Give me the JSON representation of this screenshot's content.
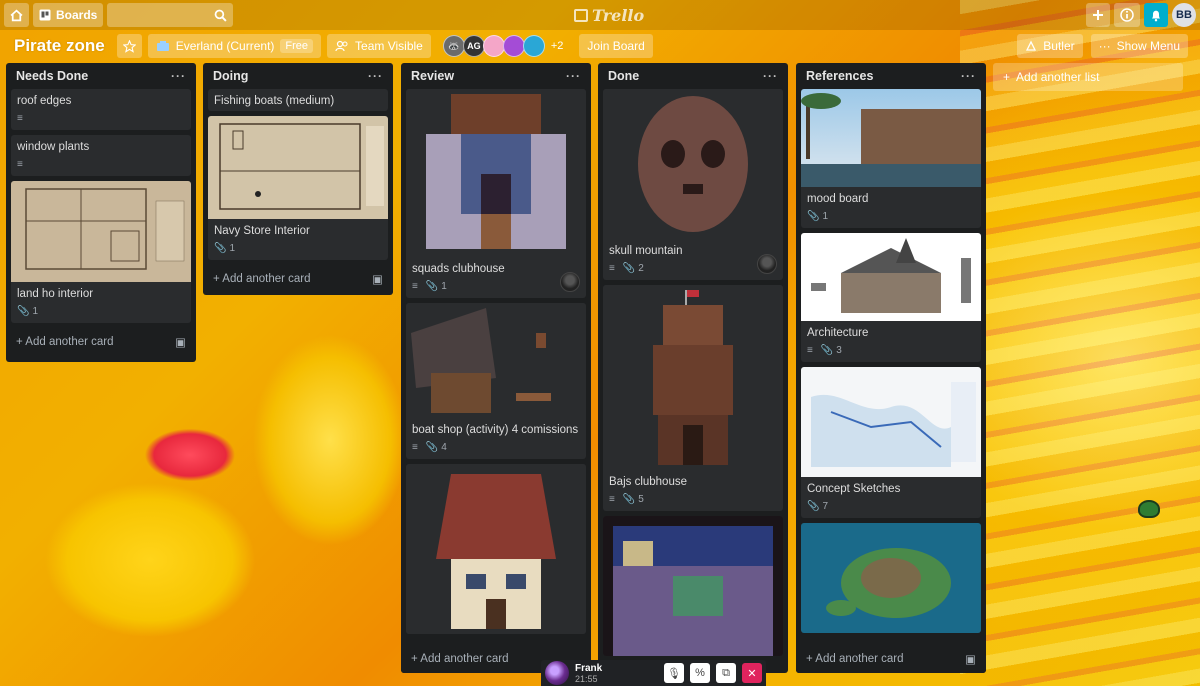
{
  "topbar": {
    "home_icon": "home-icon",
    "boards_label": "Boards",
    "search_placeholder": "",
    "logo_text": "Trello",
    "avatar_initials": "BB"
  },
  "board": {
    "title": "Pirate zone",
    "workspace": "Everland (Current)",
    "workspace_tag": "Free",
    "visibility": "Team Visible",
    "member_initials": "AG",
    "member_more": "+2",
    "join_label": "Join Board",
    "butler_label": "Butler",
    "show_menu_label": "Show Menu"
  },
  "add_list_label": "Add another list",
  "lists": [
    {
      "title": "Needs Done",
      "add_card": "Add another card",
      "cards": [
        {
          "title": "roof edges"
        },
        {
          "title": "window plants"
        },
        {
          "title": "land ho interior",
          "attachments": "1"
        }
      ]
    },
    {
      "title": "Doing",
      "add_card": "Add another card",
      "cards": [
        {
          "title": "Fishing boats (medium)"
        },
        {
          "title": "Navy Store Interior",
          "attachments": "1"
        }
      ]
    },
    {
      "title": "Review",
      "add_card": "Add another card",
      "cards": [
        {
          "title": "squads clubhouse",
          "attachments": "1"
        },
        {
          "title": "boat shop (activity) 4 comissions",
          "attachments": "4"
        },
        {
          "title": ""
        }
      ]
    },
    {
      "title": "Done",
      "cards": [
        {
          "title": "skull mountain",
          "attachments": "2"
        },
        {
          "title": "Bajs clubhouse",
          "attachments": "5"
        },
        {
          "title": ""
        }
      ]
    },
    {
      "title": "References",
      "add_card": "Add another card",
      "cards": [
        {
          "title": "mood board",
          "attachments": "1"
        },
        {
          "title": "Architecture",
          "attachments": "3"
        },
        {
          "title": "Concept Sketches",
          "attachments": "7"
        },
        {
          "title": ""
        }
      ]
    }
  ],
  "call": {
    "name": "Frank",
    "time": "21:55"
  }
}
